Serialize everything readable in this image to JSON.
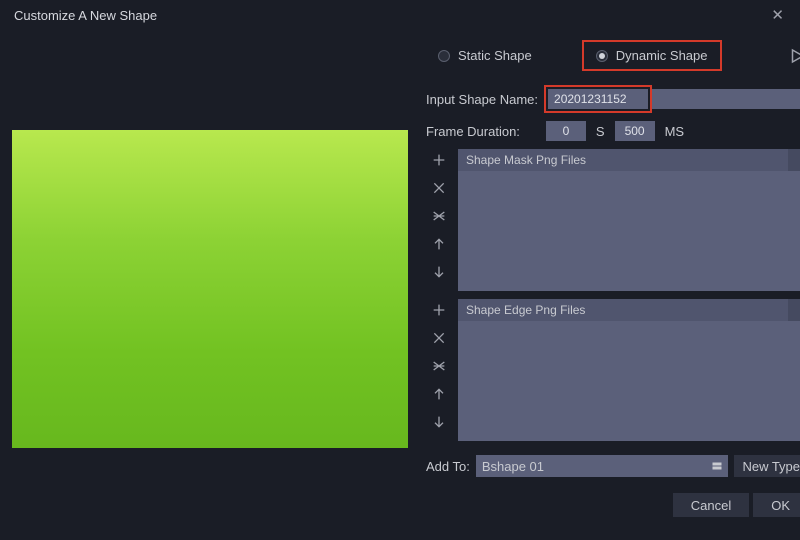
{
  "title": "Customize A New Shape",
  "shape_mode": {
    "static_label": "Static Shape",
    "dynamic_label": "Dynamic Shape",
    "selected": "dynamic"
  },
  "name_field": {
    "label": "Input Shape Name:",
    "value": "20201231152"
  },
  "duration": {
    "label": "Frame Duration:",
    "seconds": "0",
    "seconds_unit": "S",
    "ms": "500",
    "ms_unit": "MS"
  },
  "mask_panel": {
    "header": "Shape Mask Png Files"
  },
  "edge_panel": {
    "header": "Shape Edge Png Files"
  },
  "add_to": {
    "label": "Add To:",
    "value": "Bshape 01",
    "new_type": "New Type"
  },
  "footer": {
    "cancel": "Cancel",
    "ok": "OK"
  }
}
